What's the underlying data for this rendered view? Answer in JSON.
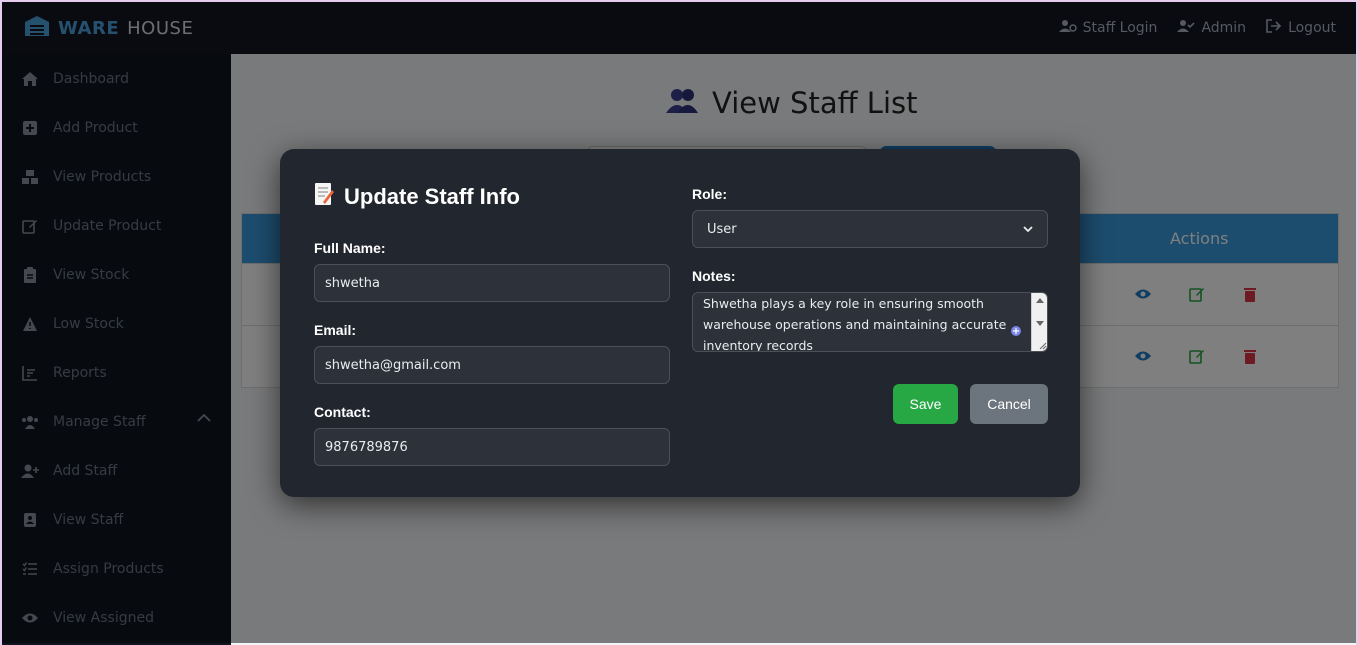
{
  "brand": {
    "ware": "WARE",
    "house": "HOUSE"
  },
  "topnav": [
    {
      "label": "Staff Login",
      "icon": "users-gear-icon"
    },
    {
      "label": "Admin",
      "icon": "user-check-icon"
    },
    {
      "label": "Logout",
      "icon": "logout-icon"
    }
  ],
  "sidebar": {
    "items": [
      {
        "label": "Dashboard",
        "icon": "home-icon"
      },
      {
        "label": "Add Product",
        "icon": "plus-square-icon"
      },
      {
        "label": "View Products",
        "icon": "boxes-icon"
      },
      {
        "label": "Update Product",
        "icon": "edit-icon"
      },
      {
        "label": "View Stock",
        "icon": "clipboard-icon"
      },
      {
        "label": "Low Stock",
        "icon": "warning-icon"
      },
      {
        "label": "Reports",
        "icon": "chart-icon"
      },
      {
        "label": "Manage Staff",
        "icon": "users-icon"
      },
      {
        "label": "Add Staff",
        "icon": "user-plus-icon"
      },
      {
        "label": "View Staff",
        "icon": "id-card-icon"
      },
      {
        "label": "Assign Products",
        "icon": "list-check-icon"
      },
      {
        "label": "View Assigned",
        "icon": "eye-icon"
      }
    ]
  },
  "page": {
    "title": "View Staff List",
    "actions_header": "Actions"
  },
  "modal": {
    "title": "Update Staff Info",
    "full_name_label": "Full Name:",
    "full_name_value": "shwetha",
    "email_label": "Email:",
    "email_value": "shwetha@gmail.com",
    "contact_label": "Contact:",
    "contact_value": "9876789876",
    "role_label": "Role:",
    "role_value": "User",
    "notes_label": "Notes:",
    "notes_value": "Shwetha plays a key role in ensuring smooth warehouse operations and maintaining accurate inventory records",
    "save_label": "Save",
    "cancel_label": "Cancel"
  },
  "colors": {
    "accent": "#3a9bdc",
    "save": "#28a745",
    "cancel": "#6c757d",
    "view_action": "#1e7bc4",
    "edit_action": "#28a745",
    "delete_action": "#dc3545"
  }
}
